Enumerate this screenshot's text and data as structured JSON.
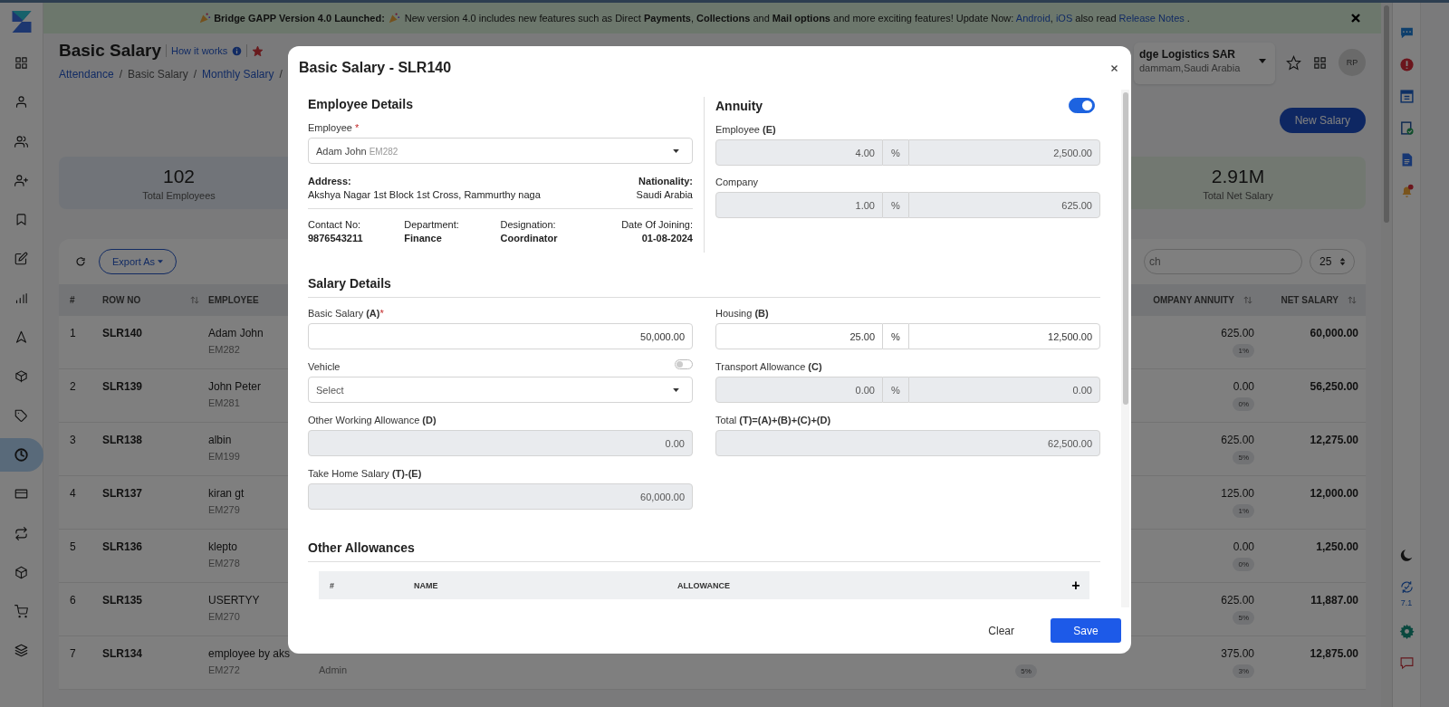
{
  "sidebar": {
    "items": [
      {
        "selected": false
      },
      {
        "selected": false
      },
      {
        "selected": false
      },
      {
        "selected": false
      },
      {
        "selected": false
      },
      {
        "selected": false
      },
      {
        "selected": false
      },
      {
        "selected": false
      },
      {
        "selected": false
      },
      {
        "selected": false
      },
      {
        "selected": true
      },
      {
        "selected": false
      },
      {
        "selected": false
      },
      {
        "selected": false
      },
      {
        "selected": false
      },
      {
        "selected": false
      }
    ]
  },
  "banner": {
    "headline": "Bridge GAPP Version 4.0 Launched:",
    "parts": [
      {
        "kind": "text",
        "text": "New version 4.0 includes new features such as Direct **Payments**, **Collections** and **Mail options** and more exciting features! Update Now: "
      },
      {
        "kind": "link",
        "text": "Android"
      },
      {
        "kind": "text",
        "text": ", "
      },
      {
        "kind": "link",
        "text": "iOS"
      },
      {
        "kind": "text",
        "text": " also read "
      },
      {
        "kind": "link",
        "text": "Release Notes"
      },
      {
        "kind": "text",
        "text": " ."
      }
    ]
  },
  "page_header": {
    "title": "Basic Salary",
    "help_link": "How it works",
    "favorite": true,
    "breadcrumb": [
      {
        "text": "Attendance",
        "link": true
      },
      {
        "text": "/",
        "link": false
      },
      {
        "text": "Basic Salary",
        "link": false
      },
      {
        "text": "/",
        "link": false
      },
      {
        "text": "Monthly Salary",
        "link": true
      },
      {
        "text": "/",
        "link": false
      }
    ],
    "company": {
      "name": "dge Logistics SAR",
      "location": "dammam,Saudi Arabia"
    },
    "avatar": "RP"
  },
  "new_button": "New Salary",
  "stats": [
    {
      "value": "102",
      "label": "Total Employees"
    },
    {
      "value": "2.91M",
      "label": "Total Net Salary"
    }
  ],
  "table": {
    "export_button": "Export As",
    "search": {
      "placeholder": "ch"
    },
    "page_size": "25",
    "columns": {
      "index": "#",
      "row_no": "ROW NO",
      "employee": "EMPLOYEE",
      "company_annuity": "OMPANY ANNUITY",
      "net_salary": "NET SALARY"
    },
    "rows": [
      {
        "index": "1",
        "row_no": "SLR140",
        "name": "Adam John",
        "code": "EM282",
        "company_annuity": "625.00",
        "company_annuity_rate": "1%",
        "net_salary": "60,000.00"
      },
      {
        "index": "2",
        "row_no": "SLR139",
        "name": "John Peter",
        "code": "EM281",
        "company_annuity": "0.00",
        "company_annuity_rate": "0%",
        "net_salary": "56,250.00"
      },
      {
        "index": "3",
        "row_no": "SLR138",
        "name": "albin",
        "code": "EM199",
        "company_annuity": "625.00",
        "company_annuity_rate": "5%",
        "net_salary": "12,275.00"
      },
      {
        "index": "4",
        "row_no": "SLR137",
        "name": "kiran gt",
        "code": "EM279",
        "company_annuity": "125.00",
        "company_annuity_rate": "1%",
        "net_salary": "12,000.00"
      },
      {
        "index": "5",
        "row_no": "SLR136",
        "name": "klepto",
        "code": "EM278",
        "company_annuity": "0.00",
        "company_annuity_rate": "0%",
        "net_salary": "1,250.00"
      },
      {
        "index": "6",
        "row_no": "SLR135",
        "name": "USERTYY",
        "code": "EM270",
        "company_annuity": "625.00",
        "company_annuity_rate": "5%",
        "net_salary": "11,887.00"
      },
      {
        "index": "7",
        "row_no": "SLR134",
        "name": "employee by aks",
        "code": "EM272",
        "column_4": "Admin",
        "column_5": "5%",
        "company_annuity": "375.00",
        "company_annuity_rate": "3%",
        "net_salary": "12,875.00"
      }
    ]
  },
  "rail": {
    "version": "7.1"
  },
  "modal": {
    "title": "Basic Salary - SLR140",
    "employee_details": {
      "heading": "Employee Details",
      "employee_label": "Employee",
      "required_mark": "*",
      "employee_name": "Adam John",
      "employee_code": "EM282",
      "address_label": "Address:",
      "address": "Akshya Nagar 1st Block 1st Cross, Rammurthy naga",
      "nationality_label": "Nationality:",
      "nationality": "Saudi Arabia",
      "facts": [
        {
          "label": "Contact No:",
          "value": "9876543211"
        },
        {
          "label": "Department:",
          "value": "Finance"
        },
        {
          "label": "Designation:",
          "value": "Coordinator"
        },
        {
          "label": "Date Of Joining:",
          "value": "01-08-2024"
        }
      ]
    },
    "annuity": {
      "heading": "Annuity",
      "on": true,
      "rows": [
        {
          "label": "Employee **(E)**",
          "disabled": true,
          "rate": "4.00",
          "unit": "%",
          "amount": "2,500.00"
        },
        {
          "label": "Company",
          "disabled": true,
          "rate": "1.00",
          "unit": "%",
          "amount": "625.00"
        }
      ]
    },
    "salary_details": {
      "heading": "Salary Details",
      "fields": [
        {
          "kind": "input",
          "label": "Basic Salary **(A)**",
          "required_mark": "*",
          "disabled": false,
          "value": "50,000.00"
        },
        {
          "kind": "split",
          "label": "Housing **(B)**",
          "disabled": false,
          "rate": "25.00",
          "unit": "%",
          "amount": "12,500.00"
        },
        {
          "kind": "select",
          "label": "Vehicle",
          "toggle_on": false,
          "placeholder": "Select"
        },
        {
          "kind": "split",
          "label": "Transport Allowance **(C)**",
          "disabled": true,
          "rate": "0.00",
          "unit": "%",
          "amount": "0.00"
        },
        {
          "kind": "input",
          "label": "Other Working Allowance **(D)**",
          "disabled": true,
          "value": "0.00"
        },
        {
          "kind": "input",
          "label": "Total **(T)=(A)+(B)+(C)+(D)**",
          "disabled": true,
          "value": "62,500.00"
        },
        {
          "kind": "input",
          "label": "Take Home Salary **(T)-(E)**",
          "disabled": true,
          "value": "60,000.00"
        }
      ]
    },
    "other_allowances": {
      "heading": "Other Allowances",
      "columns": [
        "#",
        "NAME",
        "ALLOWANCE"
      ],
      "add_label": "+"
    },
    "clear_button": "Clear",
    "save_button": "Save"
  }
}
